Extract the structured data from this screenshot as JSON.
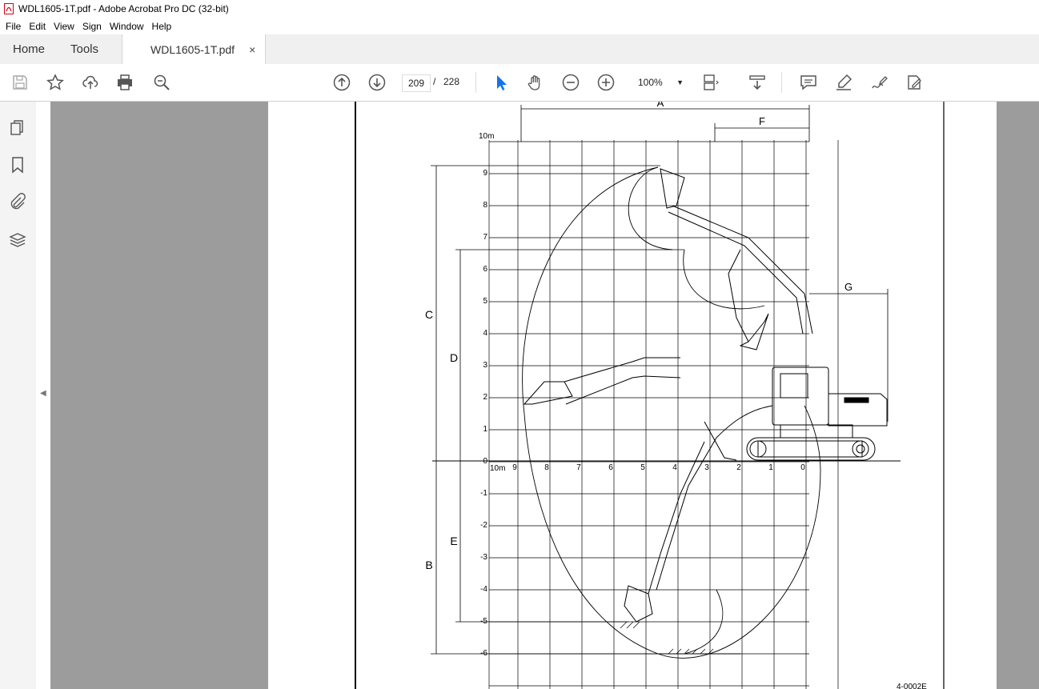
{
  "window": {
    "title": "WDL1605-1T.pdf - Adobe Acrobat Pro DC (32-bit)"
  },
  "menu": [
    "File",
    "Edit",
    "View",
    "Sign",
    "Window",
    "Help"
  ],
  "tabs": {
    "home": "Home",
    "tools": "Tools",
    "document": "WDL1605-1T.pdf",
    "close": "×"
  },
  "toolbar": {
    "icons": [
      "save-icon",
      "bookmark-star-icon",
      "upload-icon",
      "print-icon",
      "search-zoom-icon",
      "page-up-icon",
      "page-down-icon",
      "zoom-out-icon",
      "zoom-in-icon",
      "select-arrow-icon",
      "hand-icon",
      "fit-page-icon",
      "scroll-mode-icon",
      "comment-icon",
      "highlight-icon",
      "sign-icon",
      "edit-icon"
    ],
    "current_page": "209",
    "page_sep": "/",
    "total_pages": "228",
    "zoom": "100%"
  },
  "left_panel": {
    "icons": [
      "pages-icon",
      "bookmarks-icon",
      "attachments-icon",
      "layers-icon"
    ]
  },
  "drawing": {
    "dim_labels": {
      "A": "A",
      "B": "B",
      "C": "C",
      "D": "D",
      "E": "E",
      "F": "F",
      "G": "G"
    },
    "grid_top_label": "10m",
    "axis_corner_label": "10m",
    "x_ticks": [
      "9",
      "8",
      "7",
      "6",
      "5",
      "4",
      "3",
      "2",
      "1",
      "0"
    ],
    "y_ticks_up": [
      "9",
      "8",
      "7",
      "6",
      "5",
      "4",
      "3",
      "2",
      "1",
      "0"
    ],
    "y_ticks_down": [
      "-1",
      "-2",
      "-3",
      "-4",
      "-5",
      "-6"
    ],
    "figure_code": "4-0002E"
  }
}
